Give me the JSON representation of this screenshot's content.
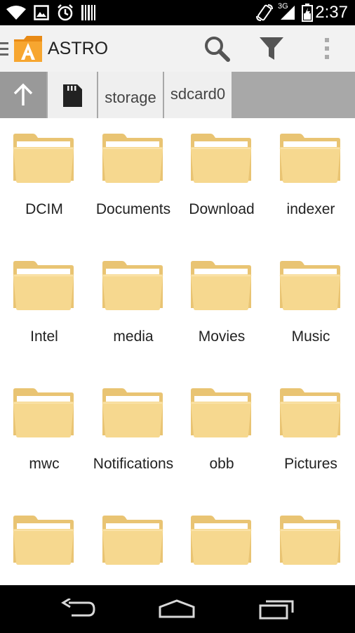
{
  "status_bar": {
    "time": "2:37",
    "network": "3G",
    "icons": [
      "wifi-icon",
      "image-icon",
      "alarm-icon",
      "barcode-icon",
      "rotate-icon",
      "signal-icon",
      "battery-icon"
    ]
  },
  "action_bar": {
    "title": "ASTRO",
    "actions": [
      "search-icon",
      "filter-icon",
      "overflow-menu-icon"
    ]
  },
  "breadcrumb": {
    "items": [
      "storage",
      "sdcard0"
    ]
  },
  "folders": [
    {
      "name": "DCIM"
    },
    {
      "name": "Documents"
    },
    {
      "name": "Download"
    },
    {
      "name": "indexer"
    },
    {
      "name": "Intel"
    },
    {
      "name": "media"
    },
    {
      "name": "Movies"
    },
    {
      "name": "Music"
    },
    {
      "name": "mwc"
    },
    {
      "name": "Notifications"
    },
    {
      "name": "obb"
    },
    {
      "name": "Pictures"
    },
    {
      "name": ""
    },
    {
      "name": ""
    },
    {
      "name": ""
    },
    {
      "name": ""
    }
  ],
  "colors": {
    "folder_body": "#f6d88f",
    "folder_back": "#e9c473",
    "folder_paper": "#ffffff",
    "accent_orange": "#f7931e"
  }
}
